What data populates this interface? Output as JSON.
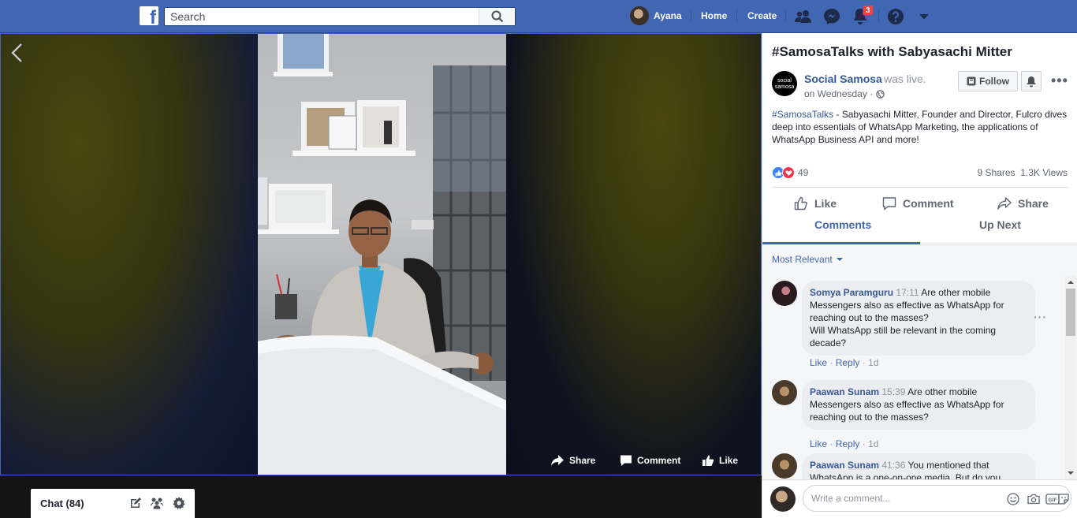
{
  "topbar": {
    "logo": "f",
    "search_placeholder": "Search",
    "user_name": "Ayana",
    "home": "Home",
    "create": "Create",
    "notifications_count": "3"
  },
  "video": {
    "share": "Share",
    "comment": "Comment",
    "like": "Like"
  },
  "chat": {
    "label": "Chat (84)"
  },
  "post": {
    "title": "#SamosaTalks with Sabyasachi Mitter",
    "page_logo": "social samosa",
    "page_name": "Social Samosa",
    "status": "was live.",
    "date": "on Wednesday",
    "date_sep": "·",
    "follow": "Follow",
    "more": "•••",
    "hashtag": "#SamosaTalks",
    "text": " - Sabyasachi Mitter, Founder and Director, Fulcro dives deep into essentials of WhatsApp Marketing, the applications of WhatsApp Business API and more!",
    "reactions_count": "49",
    "shares": "9 Shares",
    "views": "1.3K Views",
    "actions": {
      "like": "Like",
      "comment": "Comment",
      "share": "Share"
    },
    "tabs": {
      "comments": "Comments",
      "up_next": "Up Next"
    }
  },
  "comments": {
    "sort": "Most Relevant",
    "items": [
      {
        "author": "Somya Paramguru",
        "time": "17:11",
        "text": "Are other mobile Messengers also as effective as WhatsApp for reaching out to the masses?",
        "text2": "Will WhatsApp still be relevant in the coming decade?",
        "like": "Like",
        "reply": "Reply",
        "age": "1d"
      },
      {
        "author": "Paawan Sunam",
        "time": "15:39",
        "text": "Are other mobile Messengers also as effective as WhatsApp for reaching out to the masses?",
        "like": "Like",
        "reply": "Reply",
        "age": "1d"
      },
      {
        "author": "Paawan Sunam",
        "time": "41:36",
        "text": "You mentioned that WhatsApp is a one-on-one media. But do you"
      }
    ],
    "write_placeholder": "Write a comment..."
  },
  "colors": {
    "brand": "#4267b2",
    "link": "#385898",
    "badge": "#fa3e3e"
  }
}
